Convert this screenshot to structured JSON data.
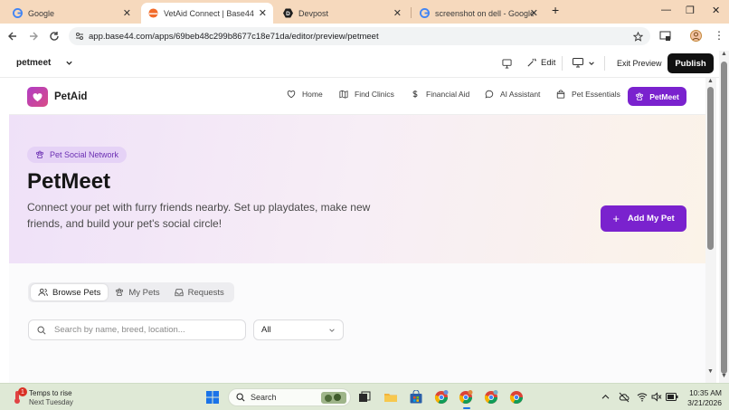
{
  "browser": {
    "tabs": [
      {
        "label": "Google",
        "active": false
      },
      {
        "label": "VetAid Connect | Base44",
        "active": true
      },
      {
        "label": "Devpost",
        "active": false
      },
      {
        "label": "screenshot on dell - Google Sea",
        "active": false
      }
    ],
    "new_tab_label": "+",
    "url": "app.base44.com/apps/69beb48c299b8677c18e71da/editor/preview/petmeet"
  },
  "editor": {
    "page_selector": "petmeet",
    "edit_label": "Edit",
    "exit_preview_label": "Exit Preview",
    "publish_label": "Publish"
  },
  "app": {
    "brand": "PetAid",
    "nav": [
      {
        "label": "Home",
        "icon": "heart-icon"
      },
      {
        "label": "Find Clinics",
        "icon": "map-icon"
      },
      {
        "label": "Financial Aid",
        "icon": "dollar-icon"
      },
      {
        "label": "AI Assistant",
        "icon": "chat-icon"
      },
      {
        "label": "Pet Essentials",
        "icon": "bag-icon"
      },
      {
        "label": "PetMeet",
        "icon": "paw-icon"
      }
    ],
    "accent": "#7a22ce"
  },
  "hero": {
    "badge": "Pet Social Network",
    "title": "PetMeet",
    "subtitle": "Connect your pet with furry friends nearby. Set up playdates, make new friends, and build your pet's social circle!",
    "add_button": "Add My Pet"
  },
  "tabs": [
    {
      "label": "Browse Pets",
      "selected": true
    },
    {
      "label": "My Pets",
      "selected": false
    },
    {
      "label": "Requests",
      "selected": false
    }
  ],
  "search": {
    "placeholder": "Search by name, breed, location..."
  },
  "filter": {
    "selected": "All"
  },
  "taskbar": {
    "weather_title": "Temps to rise",
    "weather_sub": "Next Tuesday",
    "weather_badge": "1",
    "search_label": "Search",
    "time": "10:35 AM",
    "date": "3/21/2026"
  }
}
